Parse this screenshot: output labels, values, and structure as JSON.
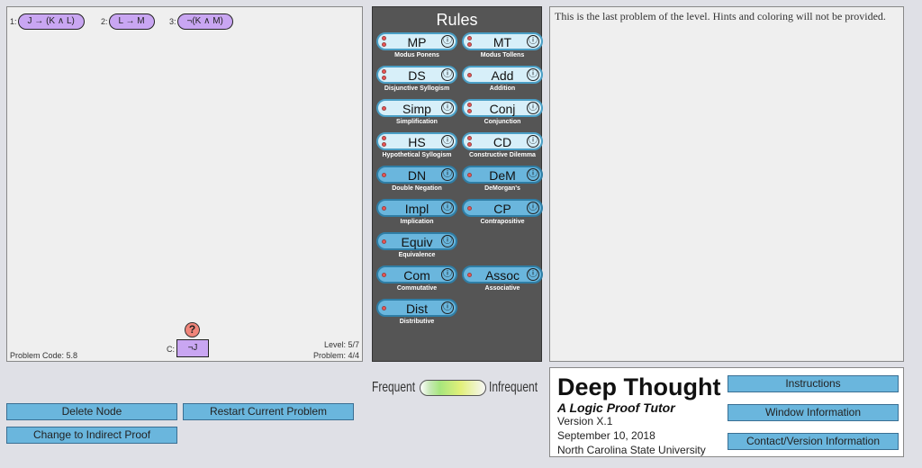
{
  "workspace": {
    "premises": [
      {
        "num": "1:",
        "formula": "J → (K ∧ L)"
      },
      {
        "num": "2:",
        "formula": "L → M"
      },
      {
        "num": "3:",
        "formula": "¬(K ∧ M)"
      }
    ],
    "help_icon": "?",
    "conclusion_label": "C:",
    "conclusion": "¬J",
    "problem_code": "Problem Code: 5.8",
    "level": "Level: 5/7",
    "problem": "Problem: 4/4"
  },
  "rules": {
    "title": "Rules",
    "info_glyph": "ⓘ",
    "items": [
      {
        "name": "MP",
        "sub": "Modus Ponens",
        "dots": 2
      },
      {
        "name": "MT",
        "sub": "Modus Tollens",
        "dots": 2
      },
      {
        "name": "DS",
        "sub": "Disjunctive Syllogism",
        "dots": 2
      },
      {
        "name": "Add",
        "sub": "Addition",
        "dots": 1
      },
      {
        "name": "Simp",
        "sub": "Simplification",
        "dots": 1
      },
      {
        "name": "Conj",
        "sub": "Conjunction",
        "dots": 2
      },
      {
        "name": "HS",
        "sub": "Hypothetical Syllogism",
        "dots": 2
      },
      {
        "name": "CD",
        "sub": "Constructive Dilemma",
        "dots": 2
      },
      {
        "name": "DN",
        "sub": "Double Negation",
        "dots": 1
      },
      {
        "name": "DeM",
        "sub": "DeMorgan's",
        "dots": 1
      },
      {
        "name": "Impl",
        "sub": "Implication",
        "dots": 1
      },
      {
        "name": "CP",
        "sub": "Contrapositive",
        "dots": 1
      },
      {
        "name": "Equiv",
        "sub": "Equivalence",
        "dots": 1
      },
      {
        "name": "Com",
        "sub": "Commutative",
        "dots": 1
      },
      {
        "name": "Assoc",
        "sub": "Associative",
        "dots": 1
      },
      {
        "name": "Dist",
        "sub": "Distributive",
        "dots": 1
      }
    ]
  },
  "hint": {
    "text": "This is the last problem of the level. Hints and coloring will not be provided."
  },
  "buttons": {
    "delete_node": "Delete Node",
    "restart": "Restart Current Problem",
    "indirect": "Change to Indirect Proof"
  },
  "frequency": {
    "left": "Frequent",
    "right": "Infrequent"
  },
  "about": {
    "title": "Deep Thought",
    "subtitle": "A Logic Proof Tutor",
    "version": "Version X.1",
    "date": "September 10, 2018",
    "university": "North Carolina State University",
    "instructions": "Instructions",
    "window_info": "Window Information",
    "contact": "Contact/Version Information"
  },
  "colors": {
    "node": "#c9a6f2",
    "rule_light": "#d7eff9",
    "rule_tinted": "#6ab6dd",
    "panel": "#555555",
    "help": "#f0857a"
  }
}
